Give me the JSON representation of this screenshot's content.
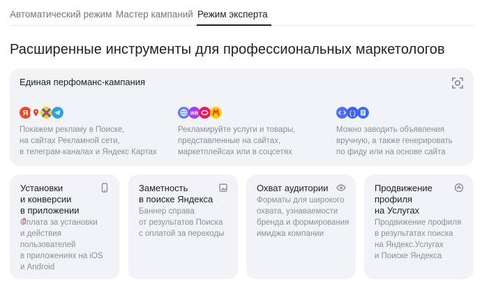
{
  "tabs": [
    {
      "label": "Автоматический режим",
      "active": false
    },
    {
      "label": "Мастер кампаний",
      "active": false
    },
    {
      "label": "Режим эксперта",
      "active": true
    }
  ],
  "page_title": "Расширенные инструменты для профессиональных маркетологов",
  "main_card": {
    "title": "Единая перфоманс-кампания",
    "expand_icon": "expand-corners-icon",
    "features": [
      {
        "icons": [
          "yandex-search-icon",
          "maps-pin-icon",
          "network-icon",
          "telegram-icon"
        ],
        "lines": [
          "Покажем рекламу в Поиске,",
          "на сайтах Рекламной сети,",
          "в телеграм-каналах и Яндекс Картах"
        ]
      },
      {
        "icons": [
          "web-globe-icon",
          "wildberries-icon",
          "ozon-icon",
          "market-icon"
        ],
        "lines": [
          "Рекламируйте услуги и товары,",
          "представленные на сайтах,",
          "маркетплейсах или в соцсетях"
        ]
      },
      {
        "icons": [
          "code-icon",
          "feed-braces-icon",
          "document-list-icon"
        ],
        "lines": [
          "Можно заводить объявления",
          "вручную, а также генерировать",
          "по фиду или на основе сайта"
        ]
      }
    ]
  },
  "cards": [
    {
      "title_lines": [
        "Установки",
        "и конверсии",
        "в приложении"
      ],
      "badge": "β",
      "icon": "phone-icon",
      "desc_lines": [
        "Оплата за установки",
        "и действия",
        "пользователей",
        "в приложениях на iOS",
        "и Android"
      ]
    },
    {
      "title_lines": [
        "Заметность",
        "в поиске Яндекса"
      ],
      "badge": "",
      "icon": "picture-icon",
      "desc_lines": [
        "Баннер справа",
        "от результатов Поиска",
        "с оплатой за переходы"
      ]
    },
    {
      "title_lines": [
        "Охват аудитории"
      ],
      "badge": "",
      "icon": "eye-icon",
      "desc_lines": [
        "Форматы для широкого",
        "охвата, узнаваемости",
        "бренда и формирования",
        "имиджа компании"
      ]
    },
    {
      "title_lines": [
        "Продвижение",
        "профиля",
        "на Услугах"
      ],
      "badge": "",
      "icon": "services-icon",
      "desc_lines": [
        "Продвижение профиля",
        "в результатах поиска",
        "на Яндекс.Услугах",
        "и Поиске Яндекса"
      ]
    }
  ],
  "colors": {
    "card_bg": "#f1f3f7",
    "text_primary": "#1f1f1f",
    "text_secondary": "#8a8f99",
    "tab_inactive": "#707683",
    "beta": "#e03131"
  }
}
